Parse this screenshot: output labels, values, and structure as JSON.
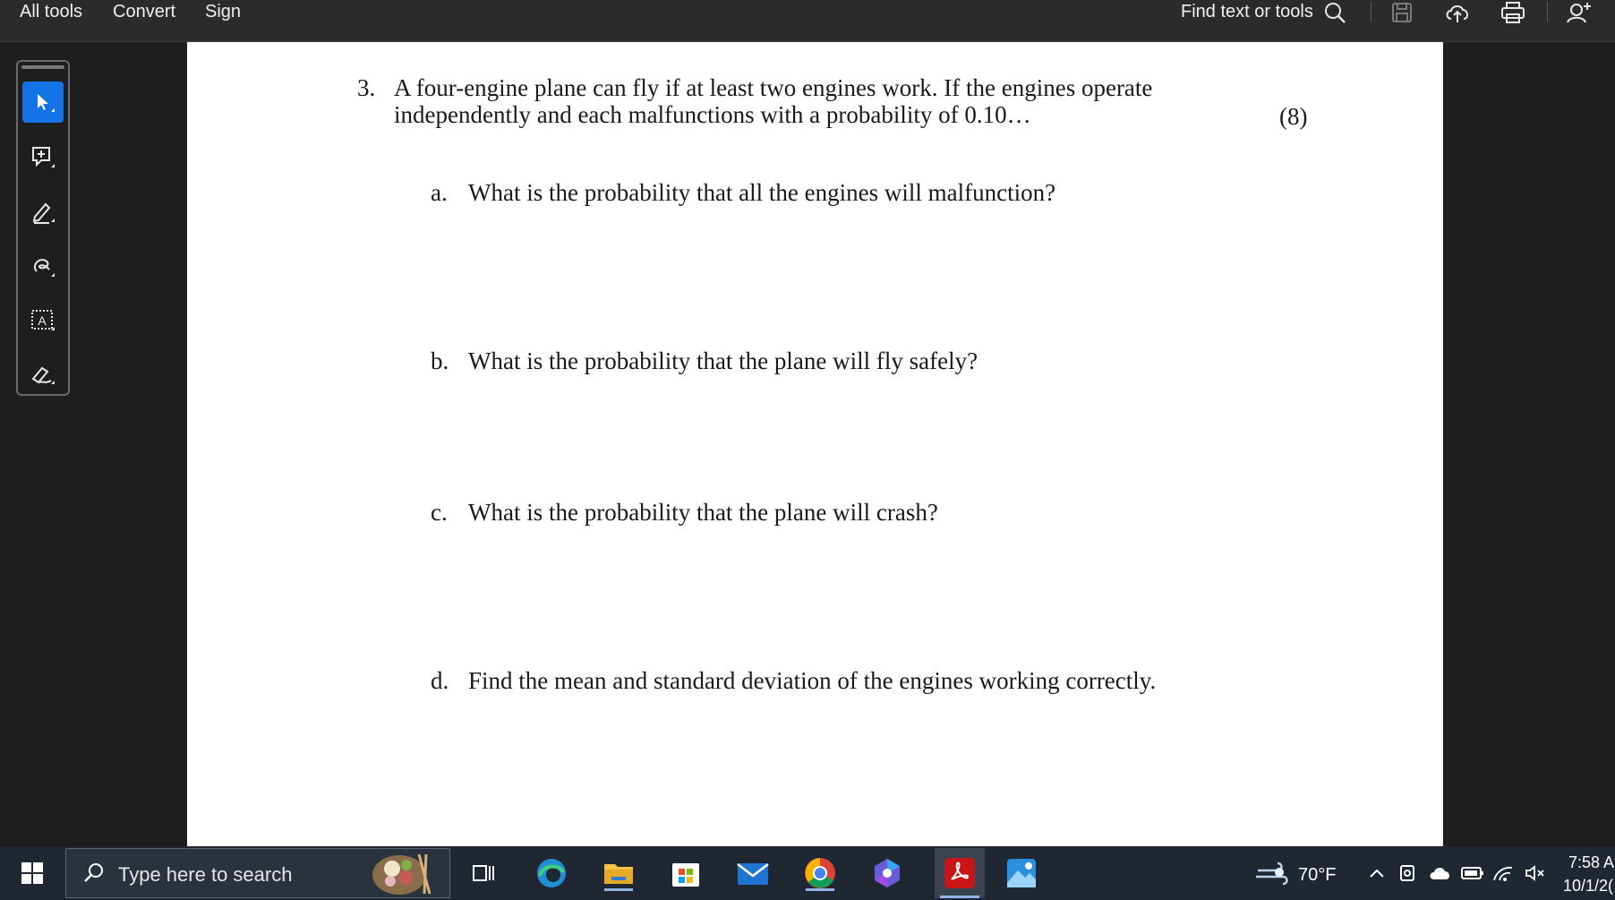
{
  "topbar": {
    "menu": [
      "All tools",
      "Convert",
      "Sign"
    ],
    "find_label": "Find text or tools"
  },
  "document": {
    "question_number": "3.",
    "question_line1": "A four-engine plane can fly if at least two engines work.  If the engines operate",
    "question_line2": "independently and each malfunctions with a probability of 0.10…",
    "points": "(8)",
    "parts": [
      {
        "letter": "a.",
        "text": "What is the probability that all the engines will malfunction?"
      },
      {
        "letter": "b.",
        "text": "What is the probability that the plane will fly safely?"
      },
      {
        "letter": "c.",
        "text": "What is the probability that the plane will crash?"
      },
      {
        "letter": "d.",
        "text": "Find the mean and standard deviation of the engines working correctly."
      }
    ]
  },
  "taskbar": {
    "search_placeholder": "Type here to search",
    "weather": "70°F",
    "time": "7:58 A",
    "date": "10/1/2("
  },
  "colors": {
    "accent": "#1473e6",
    "topbar_bg": "#2b2b2b",
    "taskbar_bg": "#1f2733"
  }
}
